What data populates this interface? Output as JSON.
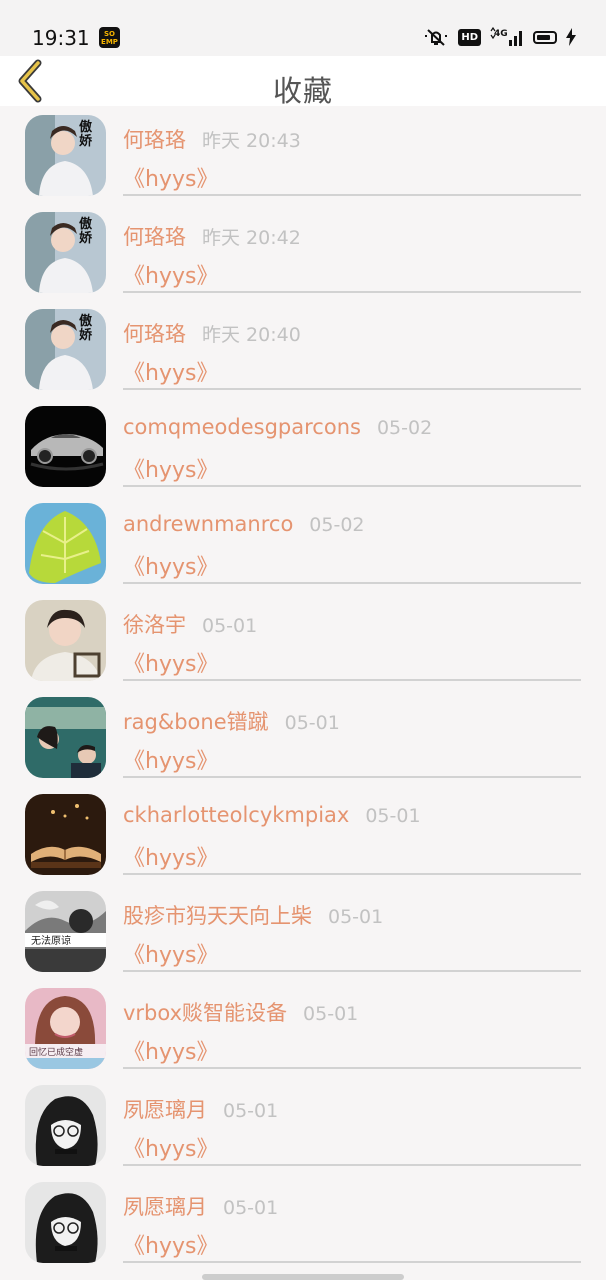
{
  "status_bar": {
    "time": "19:31",
    "app_icon_text": "SO\nEMP",
    "hd": "HD",
    "network": "4G"
  },
  "header": {
    "title": "收藏",
    "accent": "#e6c34a"
  },
  "items": [
    {
      "name": "何珞珞",
      "time": "昨天 20:43",
      "title": "《hyys》",
      "avatar": "idol-avatar-icon"
    },
    {
      "name": "何珞珞",
      "time": "昨天 20:42",
      "title": "《hyys》",
      "avatar": "idol-avatar-icon"
    },
    {
      "name": "何珞珞",
      "time": "昨天 20:40",
      "title": "《hyys》",
      "avatar": "idol-avatar-icon"
    },
    {
      "name": "comqmeodesgparcons",
      "time": "05-02",
      "title": "《hyys》",
      "avatar": "car-avatar-icon"
    },
    {
      "name": "andrewnmanrco",
      "time": "05-02",
      "title": "《hyys》",
      "avatar": "leaf-avatar-icon"
    },
    {
      "name": "徐洛宇",
      "time": "05-01",
      "title": "《hyys》",
      "avatar": "portrait-avatar-icon"
    },
    {
      "name": "rag&bone镨蹴",
      "time": "05-01",
      "title": "《hyys》",
      "avatar": "couple-avatar-icon"
    },
    {
      "name": "ckharlotteolcykmpiax",
      "time": "05-01",
      "title": "《hyys》",
      "avatar": "book-avatar-icon"
    },
    {
      "name": "股疹市犸天天向上柴",
      "time": "05-01",
      "title": "《hyys》",
      "avatar": "smoke-avatar-icon",
      "caption": "无法原谅"
    },
    {
      "name": "vrbox赕智能设备",
      "time": "05-01",
      "title": "《hyys》",
      "avatar": "girl-avatar-icon",
      "caption": "回忆已成空虚"
    },
    {
      "name": "夙愿璃月",
      "time": "05-01",
      "title": "《hyys》",
      "avatar": "anime-avatar-icon"
    },
    {
      "name": "夙愿璃月",
      "time": "05-01",
      "title": "《hyys》",
      "avatar": "anime-avatar-icon"
    }
  ]
}
